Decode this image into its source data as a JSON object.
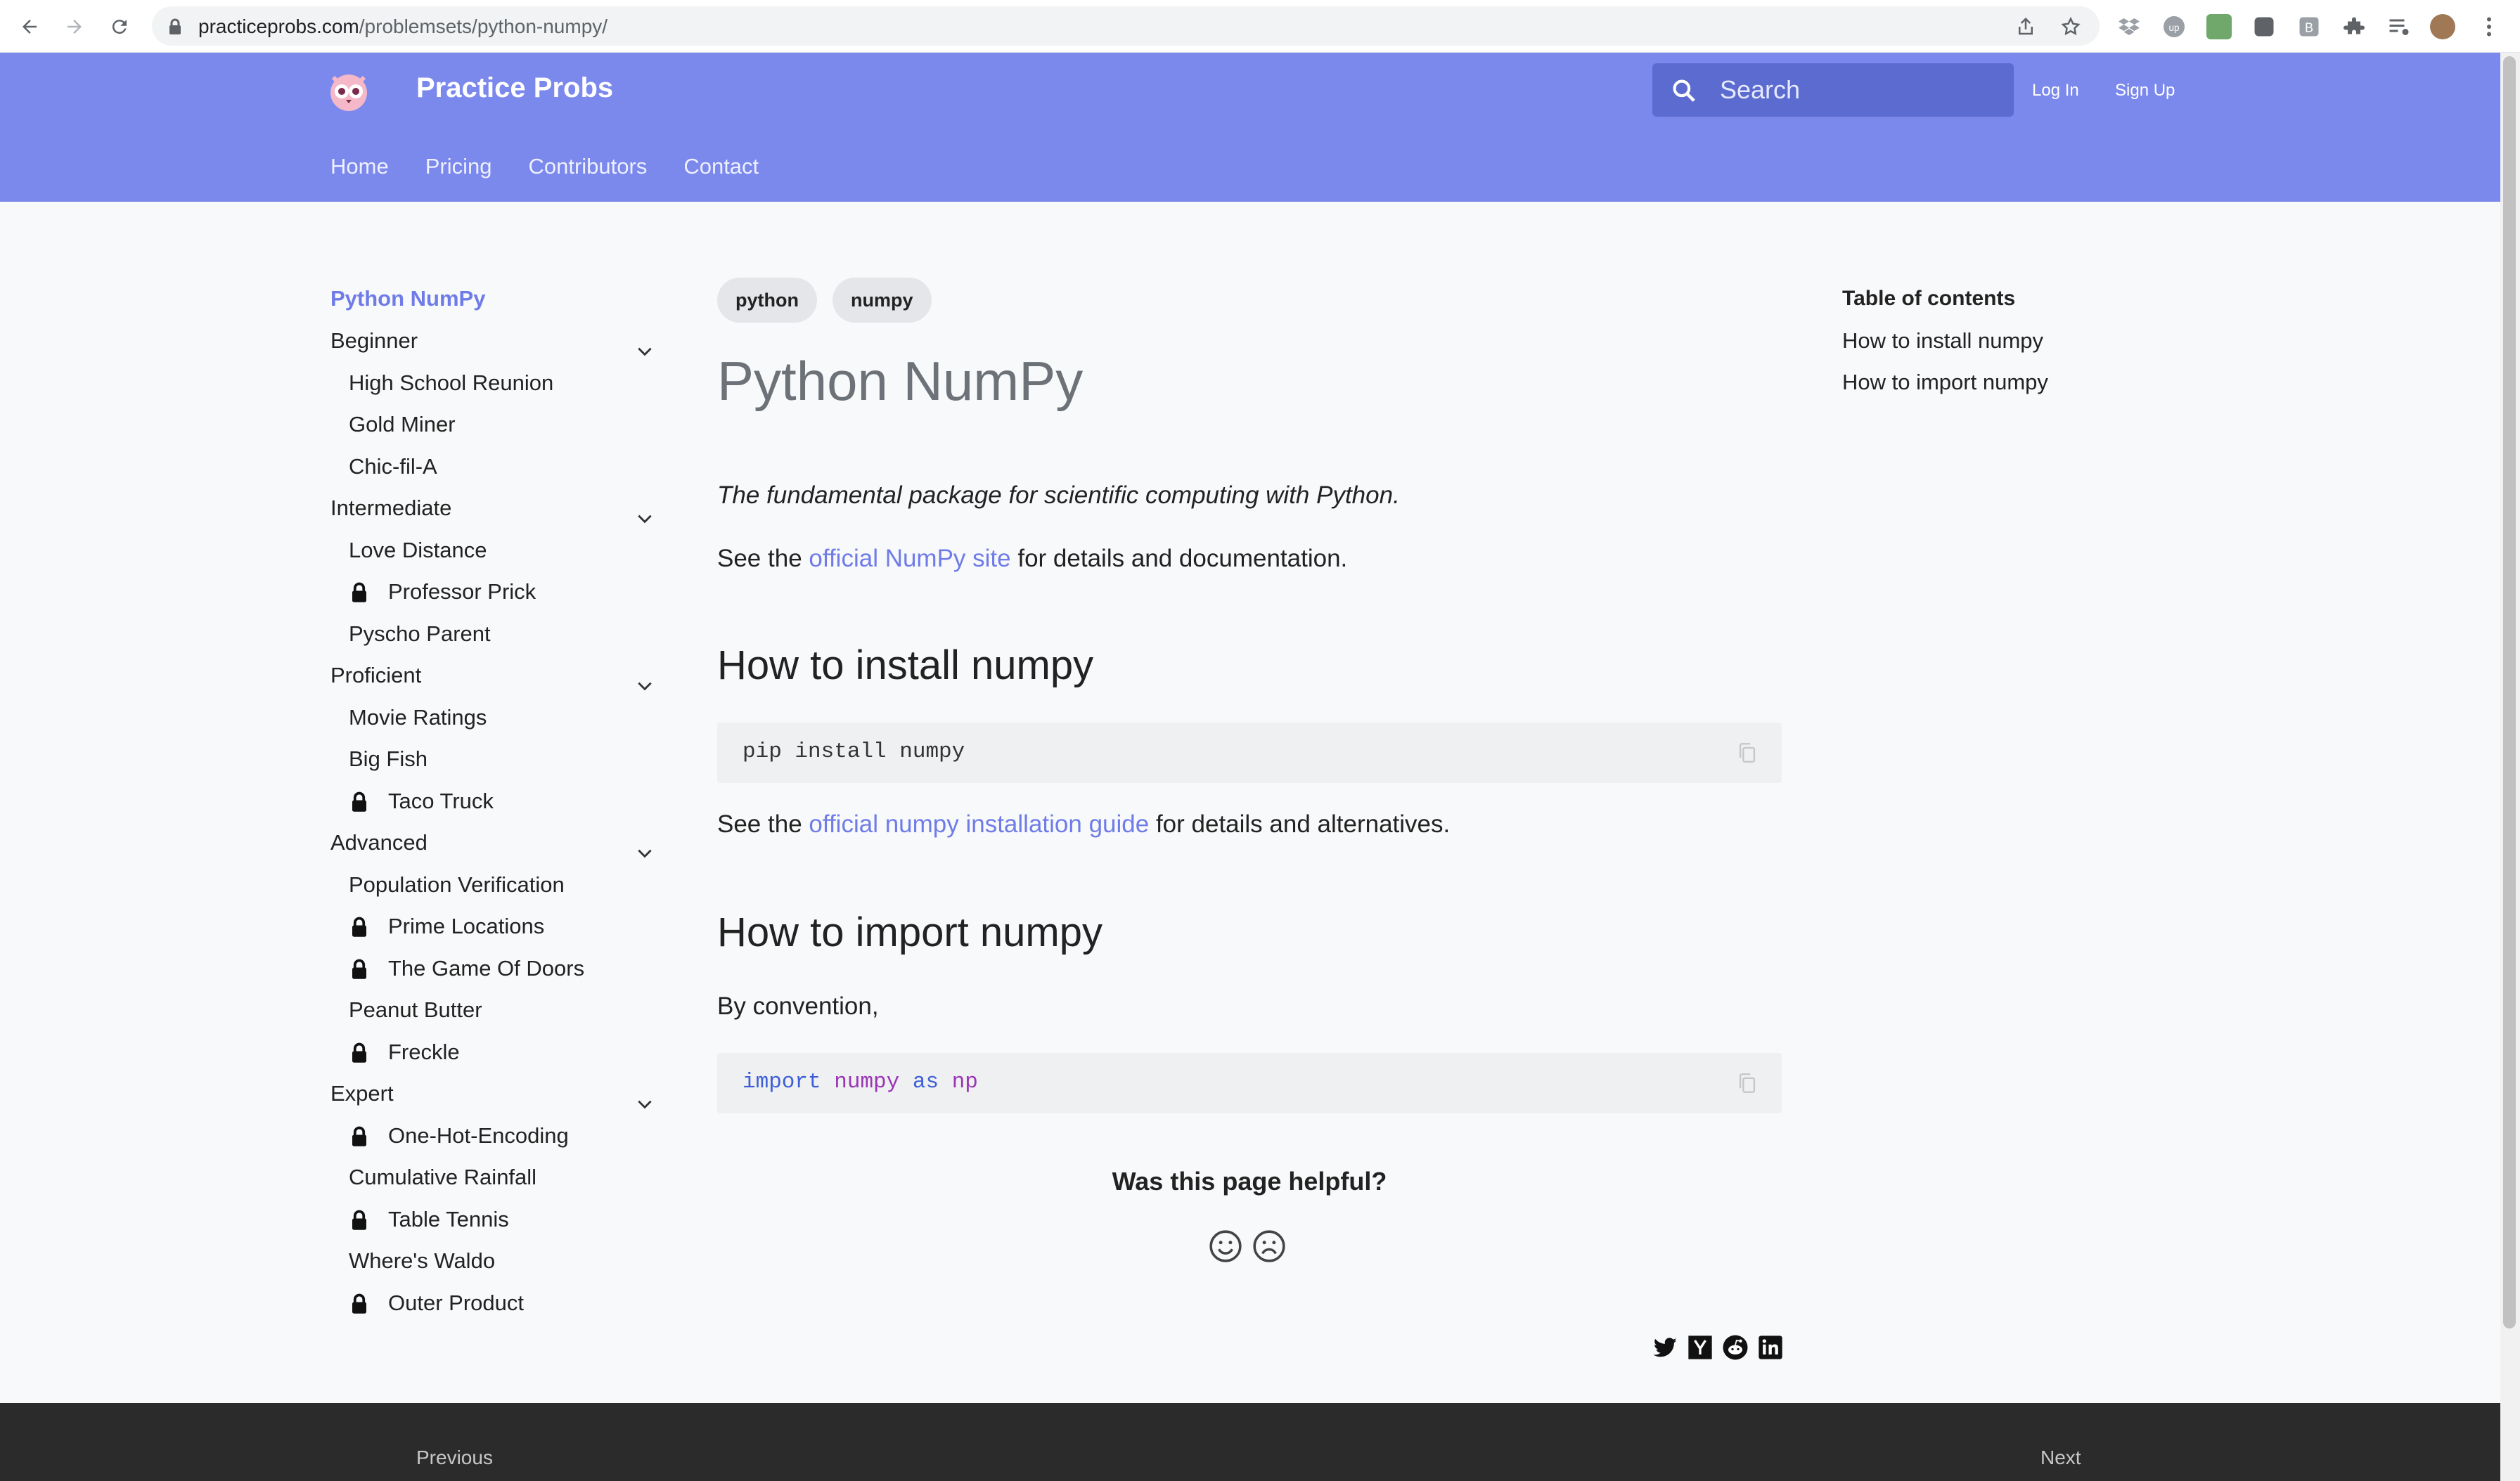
{
  "browser": {
    "url_host": "practiceprobs.com",
    "url_path": "/problemsets/python-numpy/"
  },
  "header": {
    "brand": "Practice Probs",
    "search_placeholder": "Search",
    "login": "Log In",
    "signup": "Sign Up",
    "nav": [
      "Home",
      "Pricing",
      "Contributors",
      "Contact"
    ]
  },
  "sidebar": {
    "root": "Python NumPy",
    "sections": [
      {
        "label": "Beginner",
        "items": [
          {
            "label": "High School Reunion",
            "locked": false
          },
          {
            "label": "Gold Miner",
            "locked": false
          },
          {
            "label": "Chic-fil-A",
            "locked": false
          }
        ]
      },
      {
        "label": "Intermediate",
        "items": [
          {
            "label": "Love Distance",
            "locked": false
          },
          {
            "label": "Professor Prick",
            "locked": true
          },
          {
            "label": "Pyscho Parent",
            "locked": false
          }
        ]
      },
      {
        "label": "Proficient",
        "items": [
          {
            "label": "Movie Ratings",
            "locked": false
          },
          {
            "label": "Big Fish",
            "locked": false
          },
          {
            "label": "Taco Truck",
            "locked": true
          }
        ]
      },
      {
        "label": "Advanced",
        "items": [
          {
            "label": "Population Verification",
            "locked": false
          },
          {
            "label": "Prime Locations",
            "locked": true
          },
          {
            "label": "The Game Of Doors",
            "locked": true
          },
          {
            "label": "Peanut Butter",
            "locked": false
          },
          {
            "label": "Freckle",
            "locked": true
          }
        ]
      },
      {
        "label": "Expert",
        "items": [
          {
            "label": "One-Hot-Encoding",
            "locked": true
          },
          {
            "label": "Cumulative Rainfall",
            "locked": false
          },
          {
            "label": "Table Tennis",
            "locked": true
          },
          {
            "label": "Where's Waldo",
            "locked": false
          },
          {
            "label": "Outer Product",
            "locked": true
          }
        ]
      }
    ]
  },
  "main": {
    "tags": [
      "python",
      "numpy"
    ],
    "title": "Python NumPy",
    "tagline": "The fundamental package for scientific computing with Python.",
    "see_prefix": "See the ",
    "site_link": "official NumPy site",
    "site_suffix": " for details and documentation.",
    "install_heading": "How to install numpy",
    "install_code": "pip install numpy",
    "guide_link": "official numpy installation guide",
    "guide_suffix": " for details and alternatives.",
    "import_heading": "How to import numpy",
    "convention": "By convention,",
    "import_kw1": "import",
    "import_mod": "numpy",
    "import_kw2": "as",
    "import_alias": "np",
    "helpful_question": "Was this page helpful?"
  },
  "toc": {
    "title": "Table of contents",
    "items": [
      "How to install numpy",
      "How to import numpy"
    ]
  },
  "footer": {
    "previous": "Previous",
    "next": "Next"
  },
  "colors": {
    "header_bg": "#7b88ec",
    "accent": "#6f7ce8",
    "footer_bg": "#2b2b2b"
  }
}
